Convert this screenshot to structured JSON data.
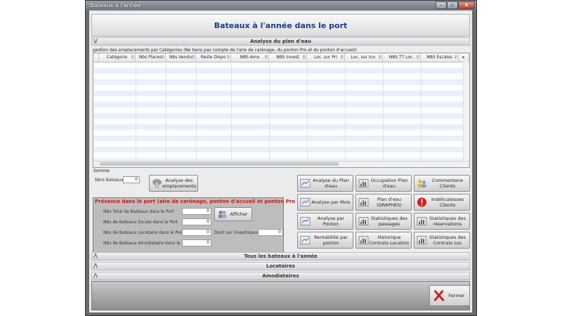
{
  "window": {
    "title": "Bateaux à l'année",
    "controls": {
      "minimize": "–",
      "maximize": "▫",
      "close": "x"
    }
  },
  "header": {
    "title": "Bateaux à l'année dans le port"
  },
  "sections": {
    "analyse": "Analyse du plan d'eau",
    "tous": "Tous les bateaux à l'année",
    "locataires": "Locataires",
    "amodiataires": "Amodiataires"
  },
  "grid": {
    "note": "gestion des emplacements par Catégories (Ne tiens pas compte de l'aire de carénage, du ponton Pro et du ponton d'accueil)",
    "columns": [
      "Catégorie",
      "Nbs Places",
      "Nbs Vendu",
      "Reste Dispo",
      "NBS Amo",
      "NBS Invest",
      "Loc. sur Pri",
      "Loc. sur Inv.",
      "NBS TT Loc.",
      "NBS Escales"
    ],
    "somme_label": "Somme"
  },
  "counts": {
    "nbrs_bateaux_label": "Nbrs Bateaux",
    "nbrs_bateaux_value": "0"
  },
  "analyse_button": "Analyse des emplacements",
  "presence": {
    "title": "Présence dans le port (aire de carénage, ponton d'accueil et ponton Pro inclus)",
    "rows": [
      {
        "label": "Nbs Total de Bateaux dans le Port",
        "value": "0"
      },
      {
        "label": "Nbs de Bateaux Escale dans le Port",
        "value": "0"
      },
      {
        "label": "Nbs de Bateaux Locataire dans le Port",
        "value": "0"
      },
      {
        "label": "Nbs de Bateaux Amodiataire dans le Port",
        "value": "0"
      }
    ],
    "afficher": "Afficher",
    "investisseur_label": "Dont sur investisseur",
    "investisseur_value": "0"
  },
  "actions": {
    "c1": [
      "Analyse du Plan d'eau",
      "Analyse par Mois",
      "Analyse par Ponton",
      "Rentabilité par ponton"
    ],
    "c2": [
      "Occupation Plan d'eau",
      "Plan d'eau (GRAPHES)",
      "Statistiques des passages",
      "Historique Contrats Location"
    ],
    "c3": [
      "Commentaire Clients",
      "Indélicatesses Clients",
      "Statistiques des réservations",
      "Statistiques des Contrats Loc"
    ]
  },
  "fermer": "Fermer",
  "colors": {
    "title_blue": "#173d8c",
    "presence_red": "#d11414",
    "row_alt": "#e8f0fb"
  }
}
